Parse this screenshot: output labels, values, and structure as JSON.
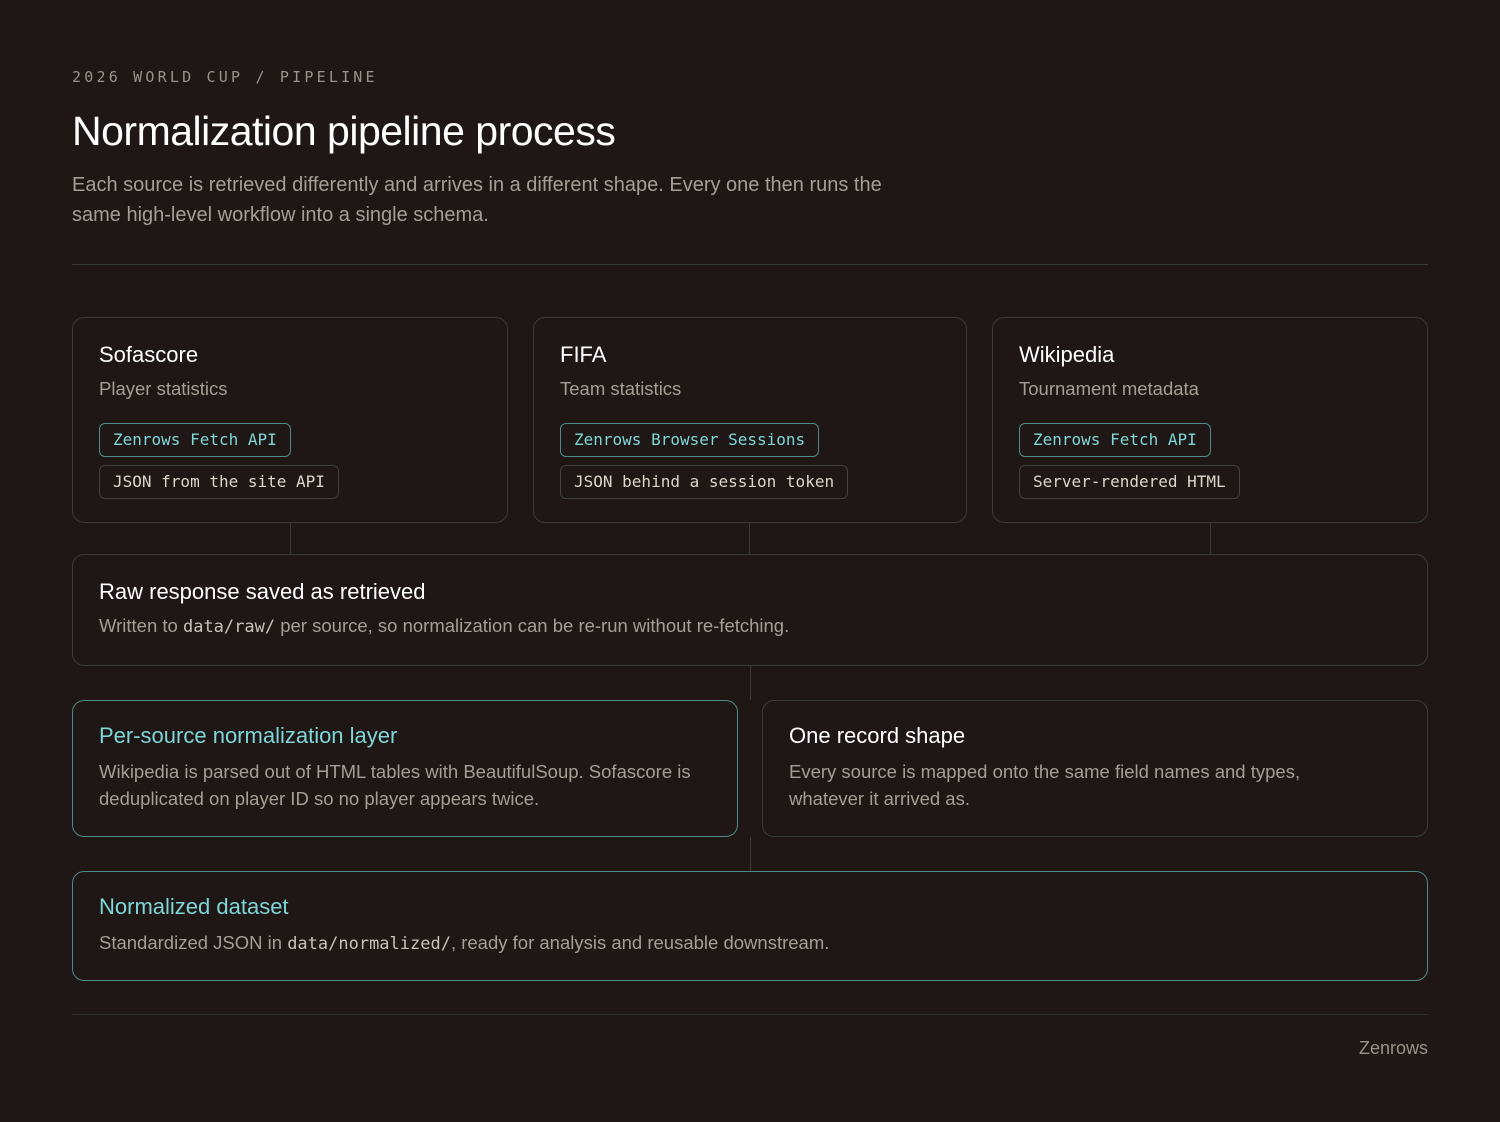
{
  "header": {
    "eyebrow": "2026 WORLD CUP / PIPELINE",
    "title": "Normalization pipeline process",
    "subtitle": "Each source is retrieved differently and arrives in a different shape. Every one then runs the same high-level workflow into a single schema."
  },
  "sources": [
    {
      "name": "Sofascore",
      "description": "Player statistics",
      "method": "Zenrows Fetch API",
      "format": "JSON from the site API"
    },
    {
      "name": "FIFA",
      "description": "Team statistics",
      "method": "Zenrows Browser Sessions",
      "format": "JSON behind a session token"
    },
    {
      "name": "Wikipedia",
      "description": "Tournament metadata",
      "method": "Zenrows Fetch API",
      "format": "Server-rendered HTML"
    }
  ],
  "raw": {
    "title": "Raw response saved as retrieved",
    "text_before": "Written to ",
    "code": "data/raw/",
    "text_after": " per source, so normalization can be re-run without re-fetching."
  },
  "normalization": {
    "title": "Per-source normalization layer",
    "text": "Wikipedia is parsed out of HTML tables with BeautifulSoup. Sofascore is deduplicated on player ID so no player appears twice."
  },
  "record_shape": {
    "title": "One record shape",
    "text": "Every source is mapped onto the same field names and types, whatever it arrived as."
  },
  "dataset": {
    "title": "Normalized dataset",
    "text_before": "Standardized JSON in ",
    "code": "data/normalized/",
    "text_after": ", ready for analysis and reusable downstream."
  },
  "footer": {
    "brand": "Zenrows"
  }
}
